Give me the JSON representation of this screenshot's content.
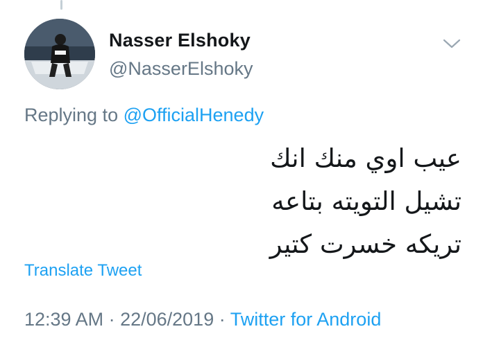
{
  "tweet": {
    "author": {
      "display_name": "Nasser Elshoky",
      "handle": "@NasserElshoky"
    },
    "replying_to_prefix": "Replying to ",
    "replying_to_handle": "@OfficialHenedy",
    "text": "عيب اوي منك انك تشيل التويته بتاعه تريكه خسرت كتير",
    "translate_label": "Translate Tweet",
    "time": "12:39 AM",
    "date": "22/06/2019",
    "separator": " · ",
    "source": "Twitter for Android"
  },
  "icons": {
    "menu": "chevron-down-icon",
    "avatar": "profile-photo"
  },
  "colors": {
    "link": "#1da1f2",
    "secondary_text": "#657786",
    "primary_text": "#14171a"
  }
}
